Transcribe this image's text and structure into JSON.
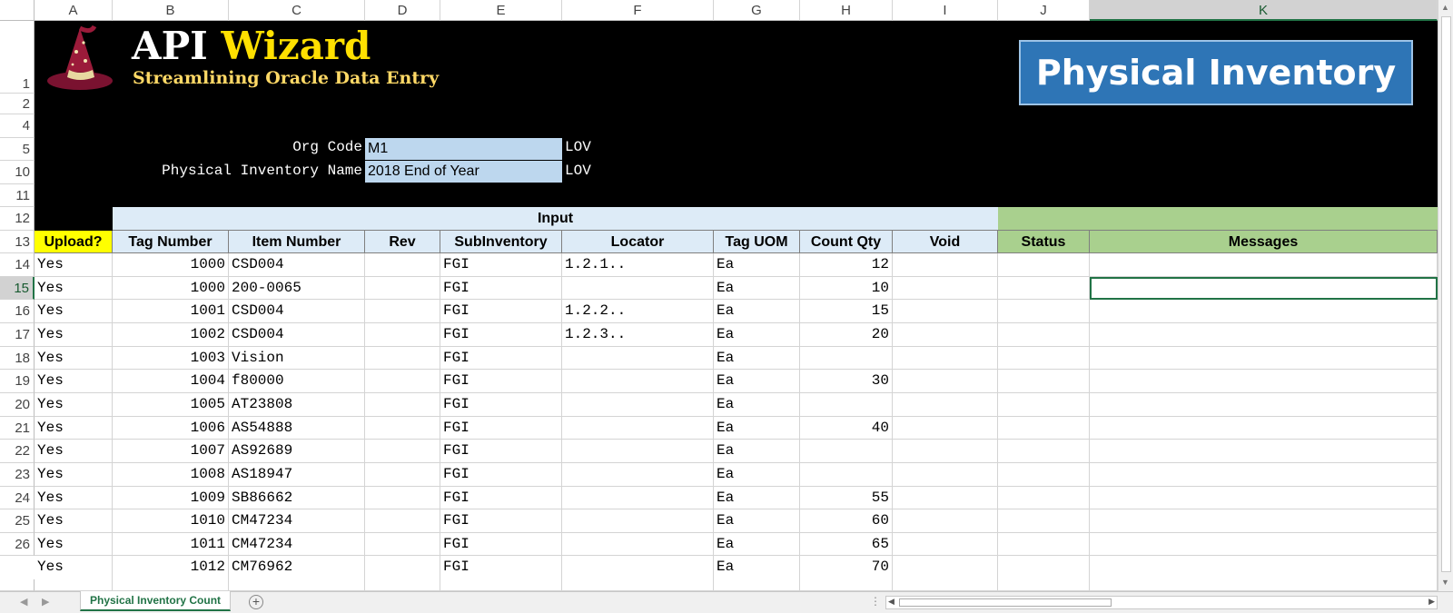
{
  "column_headers": [
    "A",
    "B",
    "C",
    "D",
    "E",
    "F",
    "G",
    "H",
    "I",
    "J",
    "K"
  ],
  "selected_column": "K",
  "row_numbers": [
    "1",
    "2",
    "4",
    "5",
    "10",
    "11",
    "12",
    "13",
    "14",
    "15",
    "16",
    "17",
    "18",
    "19",
    "20",
    "21",
    "22",
    "23",
    "24",
    "25",
    "26"
  ],
  "selected_row": "15",
  "banner": {
    "title_part1": "API ",
    "title_part2": "Wizard",
    "subtitle": "Streamlining Oracle Data Entry",
    "page_title": "Physical Inventory"
  },
  "params": {
    "org_code_label": "Org Code",
    "org_code_value": "M1",
    "org_code_lov": "LOV",
    "pi_name_label": "Physical Inventory Name",
    "pi_name_value": "2018 End of Year",
    "pi_name_lov": "LOV"
  },
  "sections": {
    "input": "Input"
  },
  "headers": [
    "Upload?",
    "Tag Number",
    "Item Number",
    "Rev",
    "SubInventory",
    "Locator",
    "Tag UOM",
    "Count Qty",
    "Void",
    "Status",
    "Messages"
  ],
  "rows": [
    {
      "upload": "Yes",
      "tag": "1000",
      "item": "CSD004",
      "rev": "",
      "sub": "FGI",
      "loc": "1.2.1..",
      "uom": "Ea",
      "qty": "12",
      "void": "",
      "status": "",
      "msg": ""
    },
    {
      "upload": "Yes",
      "tag": "1000",
      "item": "200-0065",
      "rev": "",
      "sub": "FGI",
      "loc": "",
      "uom": "Ea",
      "qty": "10",
      "void": "",
      "status": "",
      "msg": ""
    },
    {
      "upload": "Yes",
      "tag": "1001",
      "item": "CSD004",
      "rev": "",
      "sub": "FGI",
      "loc": "1.2.2..",
      "uom": "Ea",
      "qty": "15",
      "void": "",
      "status": "",
      "msg": ""
    },
    {
      "upload": "Yes",
      "tag": "1002",
      "item": "CSD004",
      "rev": "",
      "sub": "FGI",
      "loc": "1.2.3..",
      "uom": "Ea",
      "qty": "20",
      "void": "",
      "status": "",
      "msg": ""
    },
    {
      "upload": "Yes",
      "tag": "1003",
      "item": "Vision",
      "rev": "",
      "sub": "FGI",
      "loc": "",
      "uom": "Ea",
      "qty": "",
      "void": "",
      "status": "",
      "msg": ""
    },
    {
      "upload": "Yes",
      "tag": "1004",
      "item": "f80000",
      "rev": "",
      "sub": "FGI",
      "loc": "",
      "uom": "Ea",
      "qty": "30",
      "void": "",
      "status": "",
      "msg": ""
    },
    {
      "upload": "Yes",
      "tag": "1005",
      "item": "AT23808",
      "rev": "",
      "sub": "FGI",
      "loc": "",
      "uom": "Ea",
      "qty": "",
      "void": "",
      "status": "",
      "msg": ""
    },
    {
      "upload": "Yes",
      "tag": "1006",
      "item": "AS54888",
      "rev": "",
      "sub": "FGI",
      "loc": "",
      "uom": "Ea",
      "qty": "40",
      "void": "",
      "status": "",
      "msg": ""
    },
    {
      "upload": "Yes",
      "tag": "1007",
      "item": "AS92689",
      "rev": "",
      "sub": "FGI",
      "loc": "",
      "uom": "Ea",
      "qty": "",
      "void": "",
      "status": "",
      "msg": ""
    },
    {
      "upload": "Yes",
      "tag": "1008",
      "item": "AS18947",
      "rev": "",
      "sub": "FGI",
      "loc": "",
      "uom": "Ea",
      "qty": "",
      "void": "",
      "status": "",
      "msg": ""
    },
    {
      "upload": "Yes",
      "tag": "1009",
      "item": "SB86662",
      "rev": "",
      "sub": "FGI",
      "loc": "",
      "uom": "Ea",
      "qty": "55",
      "void": "",
      "status": "",
      "msg": ""
    },
    {
      "upload": "Yes",
      "tag": "1010",
      "item": "CM47234",
      "rev": "",
      "sub": "FGI",
      "loc": "",
      "uom": "Ea",
      "qty": "60",
      "void": "",
      "status": "",
      "msg": ""
    },
    {
      "upload": "Yes",
      "tag": "1011",
      "item": "CM47234",
      "rev": "",
      "sub": "FGI",
      "loc": "",
      "uom": "Ea",
      "qty": "65",
      "void": "",
      "status": "",
      "msg": ""
    },
    {
      "upload": "Yes",
      "tag": "1012",
      "item": "CM76962",
      "rev": "",
      "sub": "FGI",
      "loc": "",
      "uom": "Ea",
      "qty": "70",
      "void": "",
      "status": "",
      "msg": ""
    }
  ],
  "sheet_tab": "Physical Inventory Count",
  "add_sheet": "+",
  "colors": {
    "accent": "#217346",
    "header_blue": "#ddebf7",
    "param_blue": "#bdd7ee",
    "status_green": "#a9d08e",
    "title_box": "#2e75b6",
    "upload_yellow": "#ffff00"
  }
}
